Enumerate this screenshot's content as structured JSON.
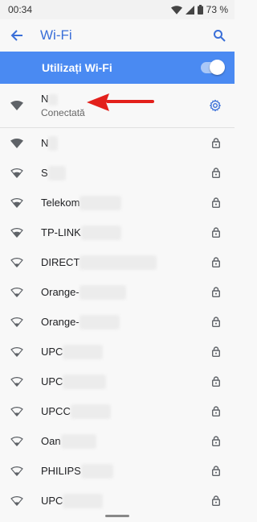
{
  "status": {
    "time": "00:34",
    "battery": "73 %"
  },
  "header": {
    "title": "Wi-Fi"
  },
  "master": {
    "label": "Utilizați Wi-Fi",
    "enabled": true
  },
  "connected": {
    "name": "N",
    "status": "Conectată"
  },
  "networks": [
    {
      "name": "N",
      "signal": "full",
      "secured": true
    },
    {
      "name": "S",
      "signal": "medium",
      "secured": true
    },
    {
      "name": "Telekom",
      "signal": "medium",
      "secured": true
    },
    {
      "name": "TP-LINK",
      "signal": "medium",
      "secured": true
    },
    {
      "name": "DIRECT",
      "signal": "weak",
      "secured": true
    },
    {
      "name": "Orange-",
      "signal": "weak",
      "secured": true
    },
    {
      "name": "Orange-",
      "signal": "weak",
      "secured": true
    },
    {
      "name": "UPC",
      "signal": "weak",
      "secured": true
    },
    {
      "name": "UPC",
      "signal": "weak",
      "secured": true
    },
    {
      "name": "UPCC",
      "signal": "weak",
      "secured": true
    },
    {
      "name": "Oan",
      "signal": "weak",
      "secured": true
    },
    {
      "name": "PHILIPS",
      "signal": "weak",
      "secured": true
    },
    {
      "name": "UPC",
      "signal": "weak",
      "secured": true
    }
  ],
  "colors": {
    "accent": "#3a6fd8",
    "master_bg": "#4a8af2",
    "arrow": "#e3201b"
  }
}
